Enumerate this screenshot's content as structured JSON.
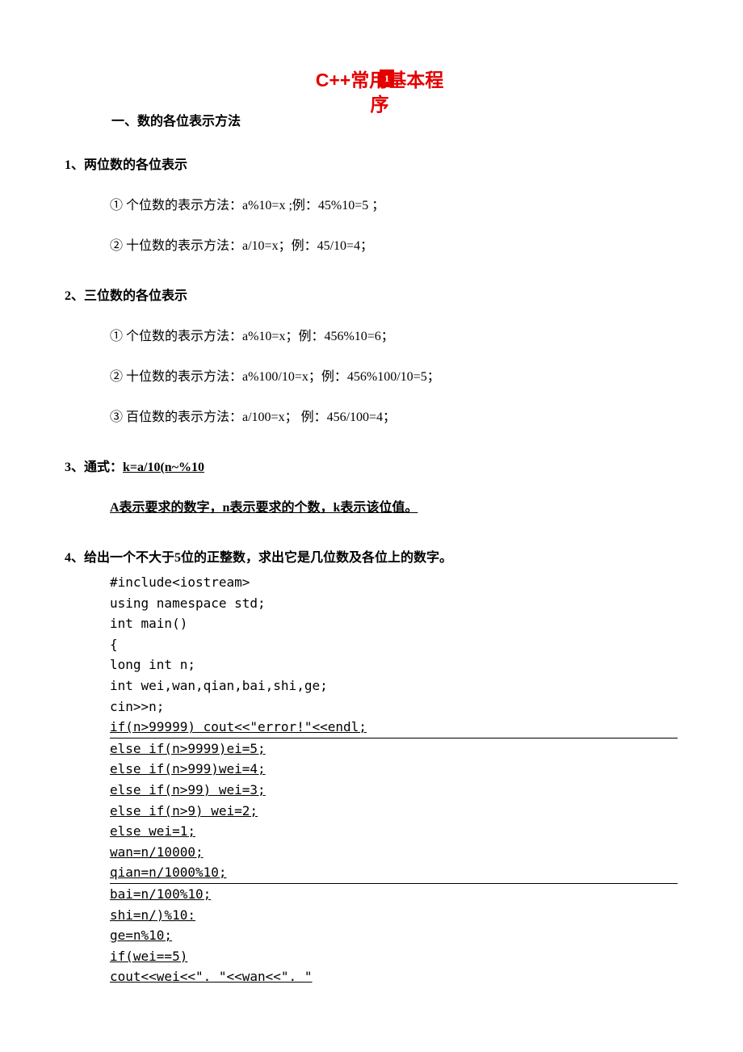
{
  "title_line1": "C++常用基本程",
  "title_line2": "序",
  "badge": "1",
  "section_heading": "一、数的各位表示方法",
  "item1": {
    "label": "1、两位数的各位表示",
    "s1": "① 个位数的表示方法：a%10=x ;例：45%10=5 ；",
    "s2": "② 十位数的表示方法：a/10=x；例：45/10=4；"
  },
  "item2": {
    "label": "2、三位数的各位表示",
    "s1": "① 个位数的表示方法：a%10=x；例：456%10=6；",
    "s2": "② 十位数的表示方法：a%100/10=x；例：456%100/10=5；",
    "s3": "③ 百位数的表示方法：a/100=x； 例：456/100=4；"
  },
  "item3": {
    "label_prefix": "3、通式：",
    "formula": "k=a/10(n~%10",
    "note": "A表示要求的数字，n表示要求的个数，k表示该位值。"
  },
  "item4": {
    "label": "4、给出一个不大于5位的正整数，求出它是几位数及各位上的数字。",
    "code": [
      {
        "t": "#include<iostream>",
        "u": false
      },
      {
        "t": "using namespace std;",
        "u": false
      },
      {
        "t": "int main()",
        "u": false
      },
      {
        "t": "{",
        "u": false
      },
      {
        "t": " long int n;",
        "u": false
      },
      {
        "t": " int wei,wan,qian,bai,shi,ge;",
        "u": false
      },
      {
        "t": " cin>>n;",
        "u": false
      },
      {
        "t": " if(n>99999) cout<<\"error!\"<<endl;",
        "u": true,
        "hr": true
      },
      {
        "t": " else if(n>9999)ei=5;",
        "u": true
      },
      {
        "t": " else if(n>999)wei=4;",
        "u": true
      },
      {
        "t": " else if(n>99) wei=3;",
        "u": true
      },
      {
        "t": " else if(n>9) wei=2;",
        "u": true
      },
      {
        "t": " else         wei=1;",
        "u": true
      },
      {
        "t": " wan=n/10000;",
        "u": true
      },
      {
        "t": " qian=n/1000%10;",
        "u": true,
        "hr": true
      },
      {
        "t": " bai=n/100%10;",
        "u": true
      },
      {
        "t": " shi=n/)%10:",
        "u": true
      },
      {
        "t": " ge=n%10;",
        "u": true
      },
      {
        "t": " if(wei==5)",
        "u": true
      },
      {
        "t": "    cout<<wei<<\". \"<<wan<<\". \"",
        "u": true
      }
    ]
  }
}
